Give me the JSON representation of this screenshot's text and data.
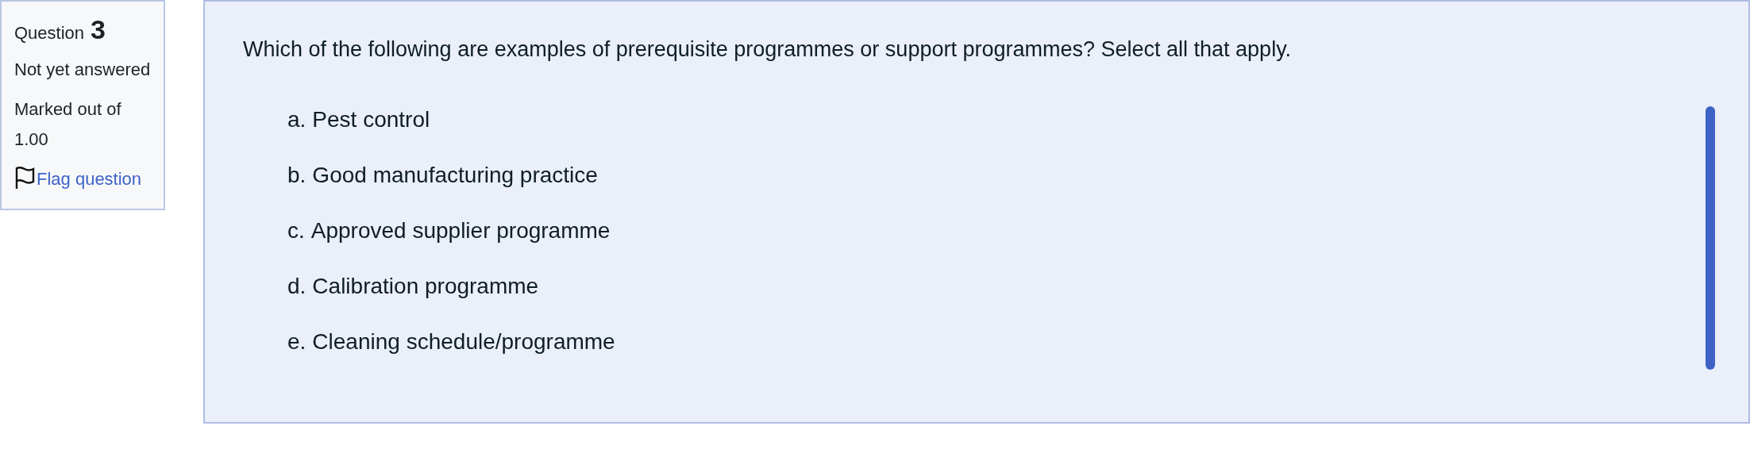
{
  "info": {
    "label": "Question",
    "number": "3",
    "status": "Not yet answered",
    "marks": "Marked out of 1.00",
    "flag_link": "Flag question"
  },
  "question": {
    "text": "Which of the following are examples of prerequisite programmes or support programmes?  Select all that apply.",
    "options": [
      {
        "letter": "a.",
        "text": "Pest control"
      },
      {
        "letter": "b.",
        "text": "Good manufacturing practice"
      },
      {
        "letter": "c.",
        "text": "Approved supplier programme"
      },
      {
        "letter": "d.",
        "text": "Calibration programme"
      },
      {
        "letter": "e.",
        "text": "Cleaning schedule/programme"
      }
    ]
  }
}
